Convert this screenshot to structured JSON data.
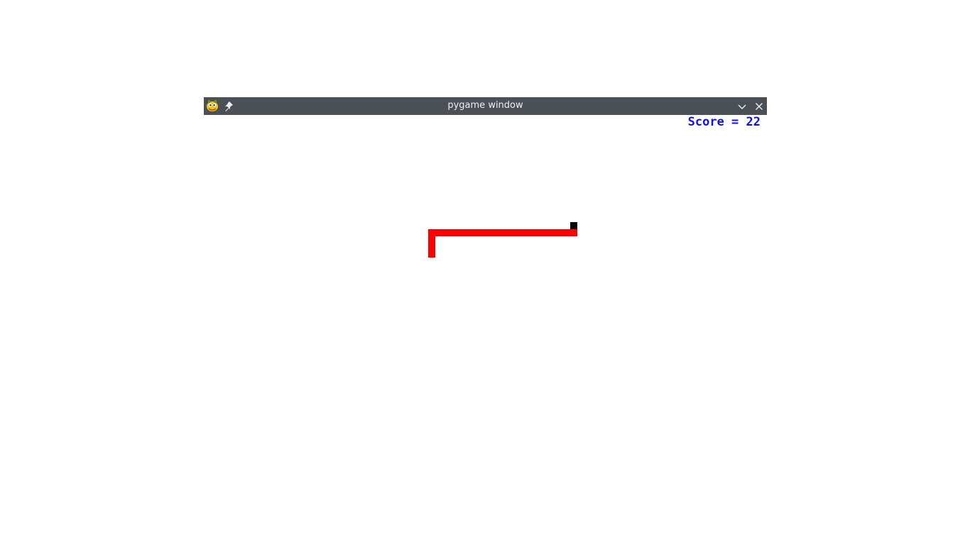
{
  "window": {
    "title": "pygame window",
    "app_icon": "pygame-snake-icon",
    "pin_icon": "pin-icon",
    "minimize_icon": "chevron-down-icon",
    "close_icon": "close-icon",
    "titlebar_color": "#4b5056"
  },
  "game": {
    "score_text": "Score = 22",
    "score_color": "#1010e6",
    "snake_color": "#ff0000",
    "food_color": "#000000",
    "background_color": "#ffffff"
  }
}
